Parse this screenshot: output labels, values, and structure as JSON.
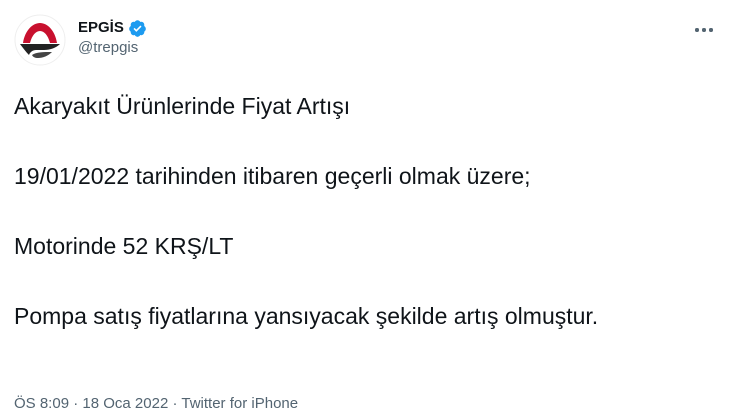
{
  "author": {
    "display_name": "EPGİS",
    "handle": "@trepgis",
    "verified": true
  },
  "tweet": {
    "paragraphs": [
      "Akaryakıt Ürünlerinde Fiyat Artışı",
      "19/01/2022 tarihinden itibaren geçerli olmak üzere;",
      "Motorinde 52 KRŞ/LT",
      "Pompa satış fiyatlarına yansıyacak şekilde artış olmuştur."
    ]
  },
  "meta": {
    "time": "ÖS 8:09",
    "separator": "·",
    "date": "18 Oca 2022",
    "source": "Twitter for iPhone"
  },
  "icons": {
    "verified": "verified-badge-icon",
    "more": "more-options-icon"
  },
  "colors": {
    "text": "#0f1419",
    "secondary": "#536471",
    "verified": "#1d9bf0",
    "logo_red": "#c8102e"
  }
}
